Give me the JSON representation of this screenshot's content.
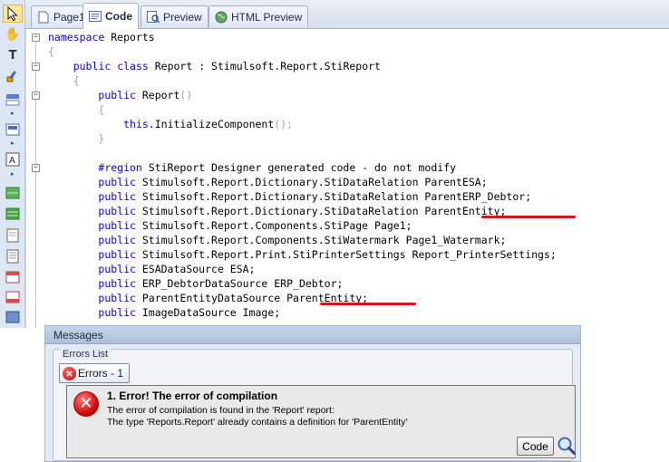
{
  "tabs": [
    {
      "label": "Page1",
      "icon": "page-icon"
    },
    {
      "label": "Code",
      "icon": "code-icon",
      "active": true
    },
    {
      "label": "Preview",
      "icon": "preview-icon"
    },
    {
      "label": "HTML Preview",
      "icon": "globe-icon"
    }
  ],
  "code": {
    "lines": [
      [
        {
          "t": "namespace",
          "c": "kw"
        },
        {
          "t": " Reports",
          "c": "pl"
        }
      ],
      [
        {
          "t": "{",
          "c": "dim"
        }
      ],
      [
        {
          "t": "    "
        },
        {
          "t": "public",
          "c": "kw"
        },
        {
          "t": " "
        },
        {
          "t": "class",
          "c": "kw"
        },
        {
          "t": " Report : Stimulsoft.Report.StiReport",
          "c": "pl"
        }
      ],
      [
        {
          "t": "    "
        },
        {
          "t": "{",
          "c": "dim"
        }
      ],
      [
        {
          "t": "        "
        },
        {
          "t": "public",
          "c": "kw"
        },
        {
          "t": " Report",
          "c": "pl"
        },
        {
          "t": "()",
          "c": "dim"
        }
      ],
      [
        {
          "t": "        "
        },
        {
          "t": "{",
          "c": "dim"
        }
      ],
      [
        {
          "t": "            "
        },
        {
          "t": "this",
          "c": "kw"
        },
        {
          "t": ".InitializeComponent",
          "c": "pl"
        },
        {
          "t": "();",
          "c": "dim"
        }
      ],
      [
        {
          "t": "        "
        },
        {
          "t": "}",
          "c": "dim"
        }
      ],
      [
        {
          "t": ""
        }
      ],
      [
        {
          "t": "        "
        },
        {
          "t": "#region",
          "c": "kw"
        },
        {
          "t": " StiReport Designer generated code - do not modify",
          "c": "pl"
        }
      ],
      [
        {
          "t": "        "
        },
        {
          "t": "public",
          "c": "kw"
        },
        {
          "t": " Stimulsoft.Report.Dictionary.StiDataRelation ParentESA;",
          "c": "pl"
        }
      ],
      [
        {
          "t": "        "
        },
        {
          "t": "public",
          "c": "kw"
        },
        {
          "t": " Stimulsoft.Report.Dictionary.StiDataRelation ParentERP_Debtor;",
          "c": "pl"
        }
      ],
      [
        {
          "t": "        "
        },
        {
          "t": "public",
          "c": "kw"
        },
        {
          "t": " Stimulsoft.Report.Dictionary.StiDataRelation ParentEntity;",
          "c": "pl"
        }
      ],
      [
        {
          "t": "        "
        },
        {
          "t": "public",
          "c": "kw"
        },
        {
          "t": " Stimulsoft.Report.Components.StiPage Page1;",
          "c": "pl"
        }
      ],
      [
        {
          "t": "        "
        },
        {
          "t": "public",
          "c": "kw"
        },
        {
          "t": " Stimulsoft.Report.Components.StiWatermark Page1_Watermark;",
          "c": "pl"
        }
      ],
      [
        {
          "t": "        "
        },
        {
          "t": "public",
          "c": "kw"
        },
        {
          "t": " Stimulsoft.Report.Print.StiPrinterSettings Report_PrinterSettings;",
          "c": "pl"
        }
      ],
      [
        {
          "t": "        "
        },
        {
          "t": "public",
          "c": "kw"
        },
        {
          "t": " ESADataSource ESA;",
          "c": "pl"
        }
      ],
      [
        {
          "t": "        "
        },
        {
          "t": "public",
          "c": "kw"
        },
        {
          "t": " ERP_DebtorDataSource ERP_Debtor;",
          "c": "pl"
        }
      ],
      [
        {
          "t": "        "
        },
        {
          "t": "public",
          "c": "kw"
        },
        {
          "t": " ParentEntityDataSource ParentEntity;",
          "c": "pl"
        }
      ],
      [
        {
          "t": "        "
        },
        {
          "t": "public",
          "c": "kw"
        },
        {
          "t": " ImageDataSource Image;",
          "c": "pl"
        }
      ]
    ]
  },
  "messages": {
    "header": "Messages",
    "group_title": "Errors List",
    "errors_tab_label": "Errors - 1",
    "error": {
      "title": "1. Error! The error of compilation",
      "line1": "The error of compilation is found in the 'Report' report:",
      "line2": "The type 'Reports.Report' already contains a definition for 'ParentEntity'"
    },
    "code_button": "Code"
  },
  "colors": {
    "keyword": "#0000ff",
    "error_underline": "#e01014",
    "error_icon": "#c70000",
    "active_tool": "#fbe79a"
  }
}
